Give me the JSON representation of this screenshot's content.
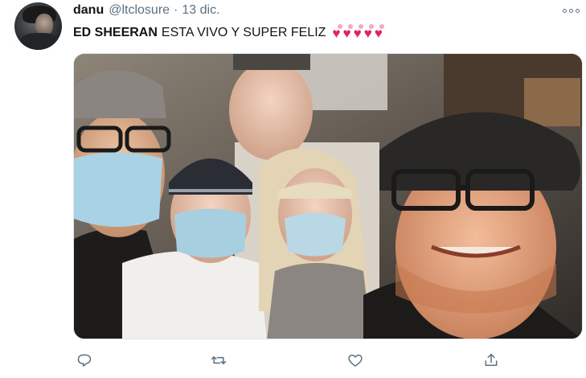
{
  "tweet": {
    "display_name": "danu",
    "handle": "@ltclosure",
    "separator": "·",
    "date": "13 dic.",
    "text_bold": "ED SHEERAN",
    "text_rest": "ESTA VIVO Y SUPER FELIZ",
    "hearts": [
      "💕",
      "💘",
      "💘",
      "💕",
      "💕"
    ]
  },
  "photo": {
    "description_icon": "group-selfie-photo"
  },
  "actions": {
    "reply_icon": "reply-icon",
    "retweet_icon": "retweet-icon",
    "like_icon": "heart-icon",
    "share_icon": "share-icon"
  },
  "colors": {
    "text_primary": "#0f1419",
    "text_secondary": "#5b7083",
    "heart": "#e0245e",
    "border": "#e1e8ed"
  }
}
